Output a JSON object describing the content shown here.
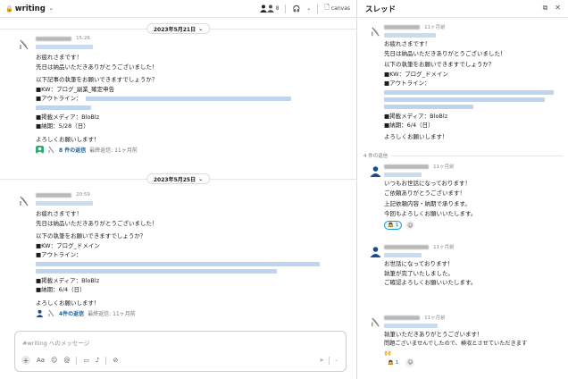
{
  "channel": {
    "name": "writing",
    "canvas_label": "canvas",
    "member_count": "8",
    "composer_placeholder": "#writing へのメッセージ",
    "composer_tools": [
      "+",
      "Aa",
      "☺",
      "@",
      "▭",
      "♪",
      "⊘"
    ]
  },
  "dates": [
    "2023年5月21日",
    "2023年5月25日"
  ],
  "messages": [
    {
      "time": "15:26",
      "greeting": "お疲れさまです！",
      "thanks": "先日は納品いただきありがとうございました！",
      "ask": "以下記事の執筆をお願いできますでしょうか？",
      "kw": "■KW：ブログ_副業_確定申告",
      "outline": "■アウトライン：",
      "media": "■掲載メディア：BloBlz",
      "deadline": "■納期：5/28（日）",
      "closing": "よろしくお願いします！",
      "replies": "8 件の返信",
      "last_reply": "最終返信: 11ヶ月前"
    },
    {
      "time": "20:59",
      "greeting": "お疲れさまです！",
      "thanks": "先日は納品いただきありがとうございました！",
      "ask": "以下の執筆をお願いできますでしょうか？",
      "kw": "■KW：ブログ_ドメイン",
      "outline": "■アウトライン：",
      "media": "■掲載メディア：BloBlz",
      "deadline": "■納期：6/4（日）",
      "closing": "よろしくお願いします！",
      "replies": "4件の返信",
      "last_reply": "最終返信: 11ヶ月前"
    }
  ],
  "thread": {
    "title": "スレッド",
    "root": {
      "time": "11ヶ月前",
      "greeting": "お疲れさまです！",
      "thanks": "先日は納品いただきありがとうございました！",
      "ask": "以下の執筆をお願いできますでしょうか？",
      "kw": "■KW：ブログ_ドメイン",
      "outline": "■アウトライン：",
      "media": "■掲載メディア：BloBlz",
      "deadline": "■納期：6/4（日）",
      "closing": "よろしくお願いします！"
    },
    "reply_count": "4 件の返信",
    "replies": [
      {
        "time": "11ヶ月前",
        "l1": "いつもお世話になっております！",
        "l2": "ご依頼ありがとうございます！",
        "l3": "上記依頼内容・納期で承ります。",
        "l4": "今回もよろしくお願いいたします。",
        "react_count": "1"
      },
      {
        "time": "11ヶ月前",
        "l1": "お世話になっております！",
        "l2": "執筆が完了いたしました。",
        "l3": "ご確認よろしくお願いいたします。"
      },
      {
        "time": "11ヶ月前",
        "l1": "執筆いただきありがとうございます！",
        "l2": "問題ございませんでしたので、検収とさせていただきます",
        "l3": "🙌",
        "react_count": "1"
      }
    ]
  },
  "colors": {
    "link": "#1264a3",
    "blur_name": "#b9b9b9",
    "blur_link": "#bfd4ee"
  }
}
